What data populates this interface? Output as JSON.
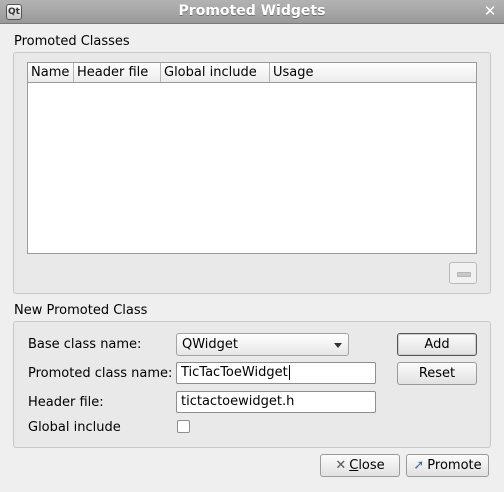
{
  "window": {
    "title": "Promoted Widgets",
    "app_icon": "Qt"
  },
  "promoted_classes": {
    "group_title": "Promoted Classes",
    "columns": [
      "Name",
      "Header file",
      "Global include",
      "Usage"
    ],
    "rows": []
  },
  "new_class": {
    "group_title": "New Promoted Class",
    "base_class_label": "Base class name:",
    "base_class_value": "QWidget",
    "promoted_class_label": "Promoted class name:",
    "promoted_class_value": "TicTacToeWidget",
    "header_file_label": "Header file:",
    "header_file_value": "tictactoewidget.h",
    "global_include_label": "Global include",
    "global_include_checked": false
  },
  "buttons": {
    "add": "Add",
    "reset": "Reset",
    "close_first": "C",
    "close_rest": "lose",
    "promote": "Promote"
  },
  "icons": {
    "close_window": "close-x-icon",
    "close_button": "close-x-icon",
    "promote_button": "promote-arrow-icon",
    "remove_button": "minus-icon"
  }
}
